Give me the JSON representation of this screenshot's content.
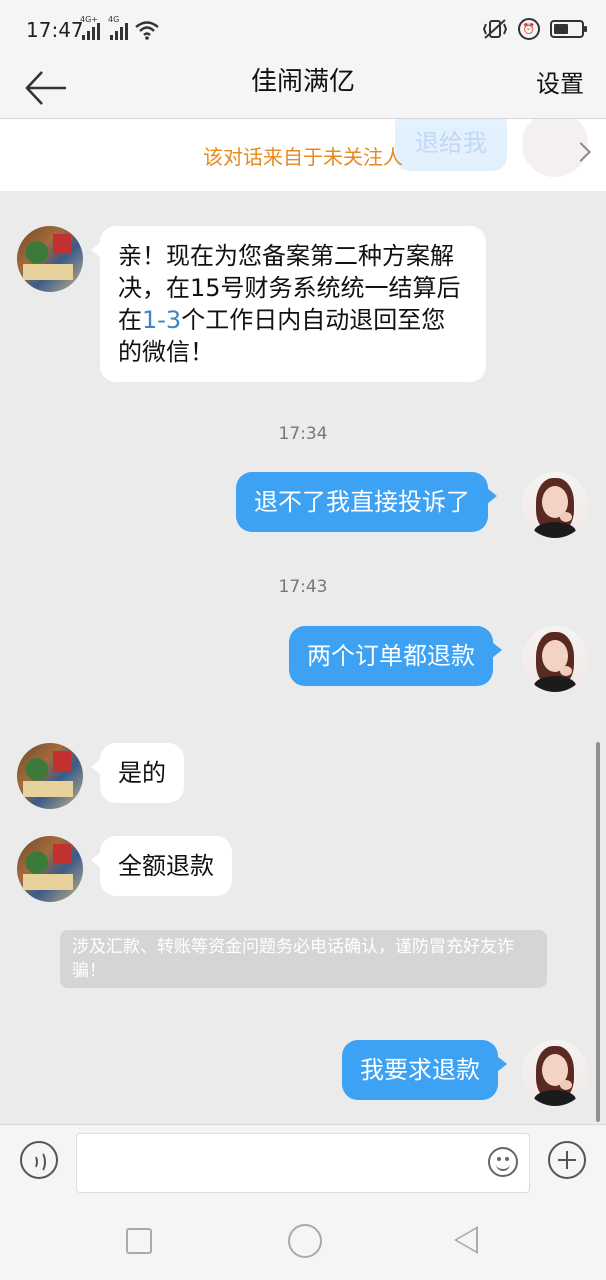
{
  "status_bar": {
    "time": "17:47",
    "signal_1_label": "4G+",
    "signal_2_label": "4G",
    "icons": [
      "signal-icon",
      "signal-icon",
      "wifi-icon",
      "vibrate-icon",
      "alarm-icon",
      "battery-icon"
    ]
  },
  "header": {
    "title": "佳闹满亿",
    "settings_label": "设置",
    "back_icon": "arrow-left-icon"
  },
  "notice": {
    "text": "该对话来自于未关注人",
    "ghost_preview": "退给我"
  },
  "messages": [
    {
      "side": "in",
      "text_parts": [
        "亲！现在为您备案第二种方案解决，在15号财务系统统一结算后在",
        "1-3",
        "个工作日内自动退回至您的微信！"
      ]
    },
    {
      "type": "time",
      "text": "17:34"
    },
    {
      "side": "out",
      "text": "退不了我直接投诉了"
    },
    {
      "type": "time",
      "text": "17:43"
    },
    {
      "side": "out",
      "text": "两个订单都退款"
    },
    {
      "side": "in",
      "text": "是的"
    },
    {
      "side": "in",
      "text": "全额退款"
    },
    {
      "side": "out",
      "text": "我要求退款"
    }
  ],
  "warning": "涉及汇款、转账等资金问题务必电话确认，谨防冒充好友诈骗！",
  "input_bar": {
    "value": "",
    "placeholder": "",
    "icons": [
      "voice-icon",
      "emoji-icon",
      "plus-icon"
    ]
  },
  "nav_bar": {
    "icons": [
      "recent-apps-icon",
      "home-icon",
      "back-icon"
    ]
  },
  "colors": {
    "outgoing_bubble": "#3da1f4",
    "incoming_bubble": "#ffffff",
    "notice_text": "#e58a1e",
    "link": "#3b86c8",
    "background": "#ebebeb"
  }
}
